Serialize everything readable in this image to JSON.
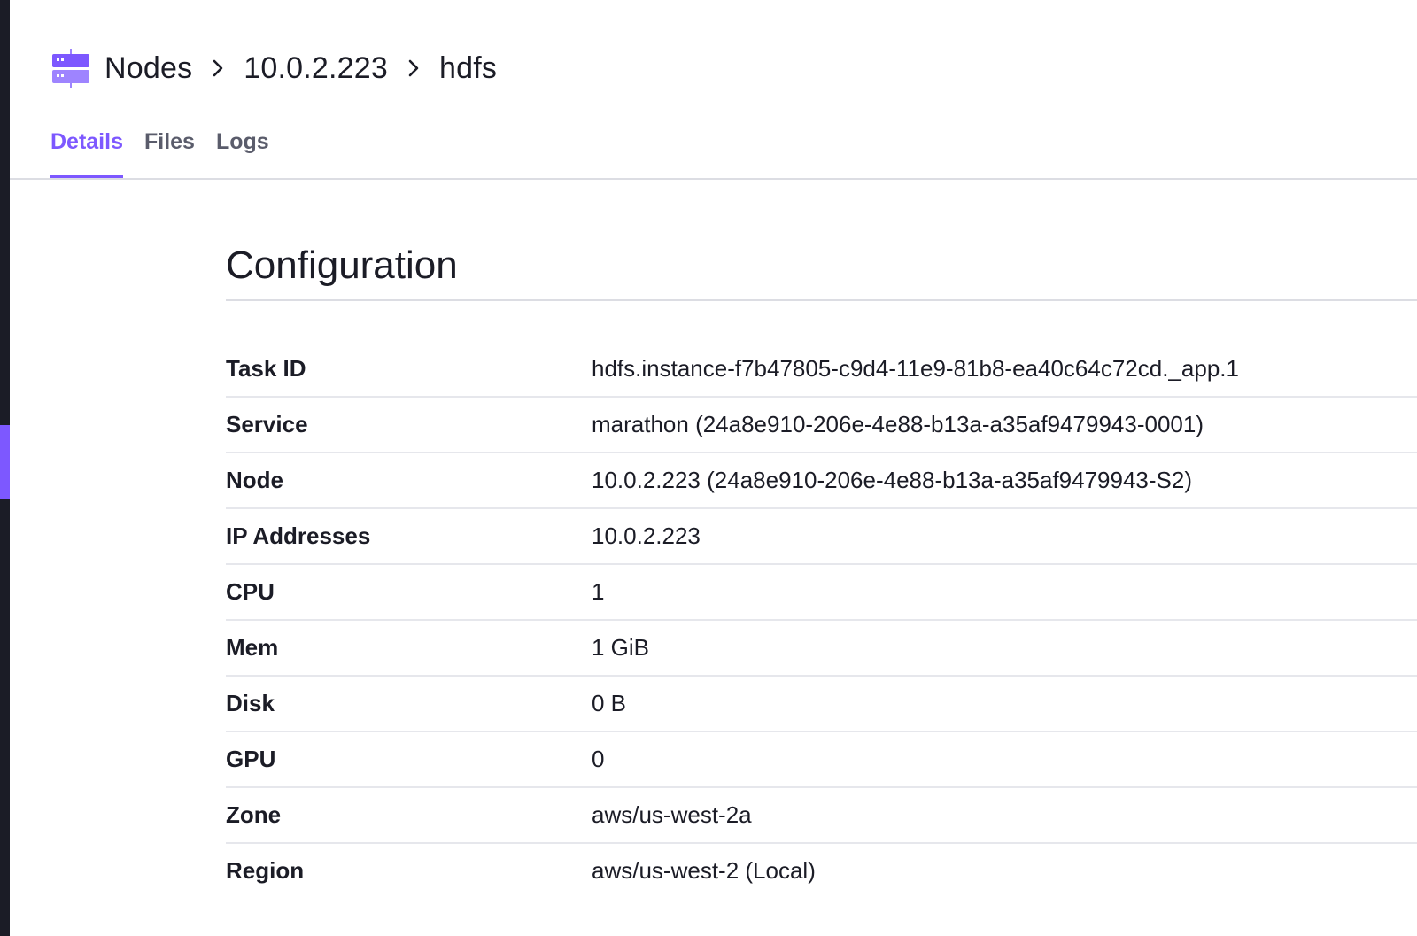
{
  "breadcrumb": {
    "icon": "nodes-server-icon",
    "items": [
      "Nodes",
      "10.0.2.223",
      "hdfs"
    ]
  },
  "tabs": [
    {
      "label": "Details",
      "active": true
    },
    {
      "label": "Files",
      "active": false
    },
    {
      "label": "Logs",
      "active": false
    }
  ],
  "configuration": {
    "title": "Configuration",
    "rows": [
      {
        "label": "Task ID",
        "value": "hdfs.instance-f7b47805-c9d4-11e9-81b8-ea40c64c72cd._app.1"
      },
      {
        "label": "Service",
        "value": "marathon (24a8e910-206e-4e88-b13a-a35af9479943-0001)"
      },
      {
        "label": "Node",
        "value": "10.0.2.223 (24a8e910-206e-4e88-b13a-a35af9479943-S2)"
      },
      {
        "label": "IP Addresses",
        "value": "10.0.2.223"
      },
      {
        "label": "CPU",
        "value": "1"
      },
      {
        "label": "Mem",
        "value": "1 GiB"
      },
      {
        "label": "Disk",
        "value": "0 B"
      },
      {
        "label": "GPU",
        "value": "0"
      },
      {
        "label": "Zone",
        "value": "aws/us-west-2a"
      },
      {
        "label": "Region",
        "value": "aws/us-west-2 (Local)"
      }
    ]
  },
  "colors": {
    "accent": "#7d58ff",
    "sidebar": "#1b1c26",
    "text": "#1b1c26",
    "muted_tab": "#5a5c6b",
    "divider": "#dcdde3"
  }
}
